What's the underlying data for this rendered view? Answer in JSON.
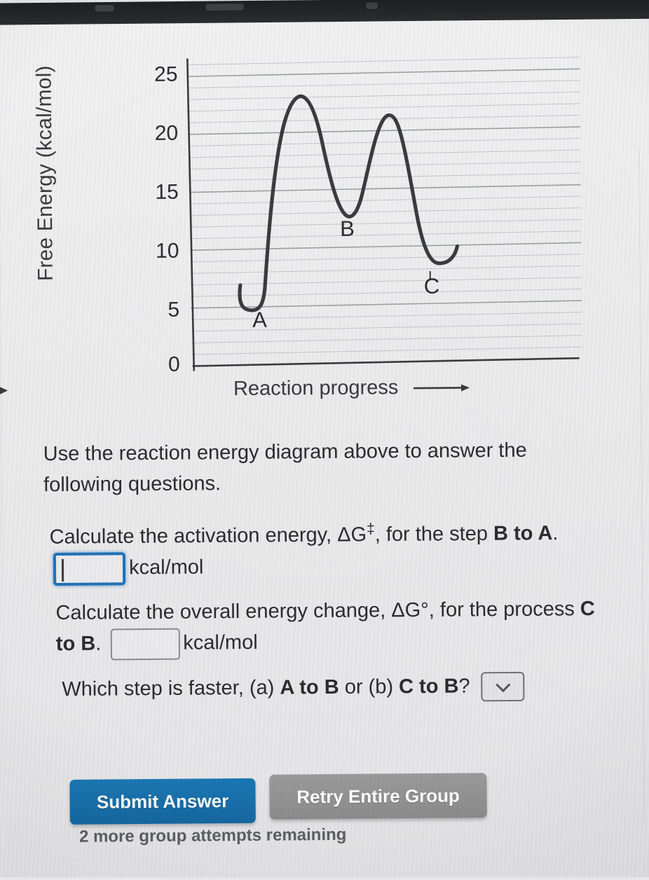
{
  "chart_data": {
    "type": "line",
    "title": "",
    "xlabel": "Reaction progress",
    "ylabel": "Free Energy (kcal/mol)",
    "x_axis_arrow": true,
    "yticks": [
      25,
      20,
      15,
      10,
      5,
      0
    ],
    "ylim": [
      0,
      26.5
    ],
    "grid": "horizontal gridlines every 1 kcal/mol, heavier every 5",
    "legend": "none",
    "point_labels": [
      "A",
      "B",
      "C"
    ],
    "annotations": [
      {
        "label": "A",
        "value": 5.5,
        "kind": "minimum"
      },
      {
        "label": "B",
        "value": 13.0,
        "kind": "minimum"
      },
      {
        "label": "C",
        "value": 9.5,
        "kind": "minimum"
      }
    ],
    "series": [
      {
        "name": "Free energy profile",
        "points": [
          {
            "x": 0.0,
            "y": 7.0,
            "note": "start"
          },
          {
            "x": 0.05,
            "y": 5.6,
            "note": "A minimum"
          },
          {
            "x": 0.12,
            "y": 5.5,
            "note": "A minimum"
          },
          {
            "x": 0.3,
            "y": 23.2,
            "note": "first transition state"
          },
          {
            "x": 0.45,
            "y": 13.0,
            "note": "B minimum"
          },
          {
            "x": 0.6,
            "y": 21.6,
            "note": "second transition state"
          },
          {
            "x": 0.78,
            "y": 9.4,
            "note": "C minimum"
          },
          {
            "x": 0.86,
            "y": 10.2,
            "note": "end"
          }
        ]
      }
    ],
    "derived": {
      "A_energy": 5.5,
      "B_energy": 13.0,
      "C_energy": 9.5,
      "TS1_energy": 23.2,
      "TS2_energy": 21.6
    }
  },
  "question_block": {
    "intro": "Use the reaction energy diagram above to answer the following questions.",
    "q1": {
      "text_before": "Calculate the activation energy, ",
      "symbol": "ΔG",
      "symbol_sup": "‡",
      "text_mid": ", for the step ",
      "bold_step": "B to A",
      "text_after_period": ".",
      "input_value": "",
      "input_placeholder": "",
      "unit": "kcal/mol"
    },
    "q2": {
      "text_before": "Calculate the overall energy change, ",
      "symbol": "ΔG°",
      "text_mid": ", for the process ",
      "bold_step": "C to B",
      "text_after_period": ".",
      "input_value": "",
      "input_placeholder": "",
      "unit": "kcal/mol"
    },
    "q3": {
      "text_before": "Which step is faster, (a) ",
      "bold_a": "A to B",
      "text_mid": " or (b) ",
      "bold_b": "C to B",
      "text_after": "?",
      "select_value": "",
      "select_icon": "chevron-down-icon"
    }
  },
  "actions": {
    "submit_label": "Submit Answer",
    "retry_label": "Retry Entire Group",
    "attempts_text": "2 more group attempts remaining",
    "submit_color": "#1a74b0",
    "retry_color": "#949494"
  },
  "theme": {
    "page_background": "#ececee",
    "text_color": "#2b2b30",
    "focus_blue": "#2272b5",
    "curve_color": "#3a3a40",
    "grid_color": "#b9bcc2"
  }
}
